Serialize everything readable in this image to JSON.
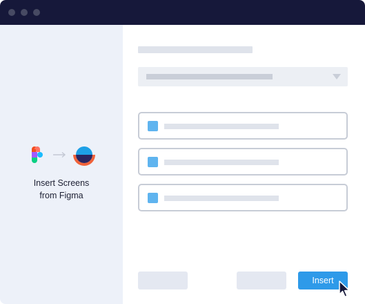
{
  "sidebar": {
    "caption_line1": "Insert Screens",
    "caption_line2": "from Figma"
  },
  "icons": {
    "figma": "figma-logo-icon",
    "arrow": "arrow-right-icon",
    "target": "target-app-logo-icon",
    "caret": "caret-down-icon",
    "cursor": "mouse-pointer-icon"
  },
  "footer": {
    "insert_label": "Insert"
  },
  "colors": {
    "titlebar": "#16183a",
    "sidebar": "#edf1f9",
    "accent": "#2e9ae9",
    "checkbox": "#5fb4ef"
  }
}
